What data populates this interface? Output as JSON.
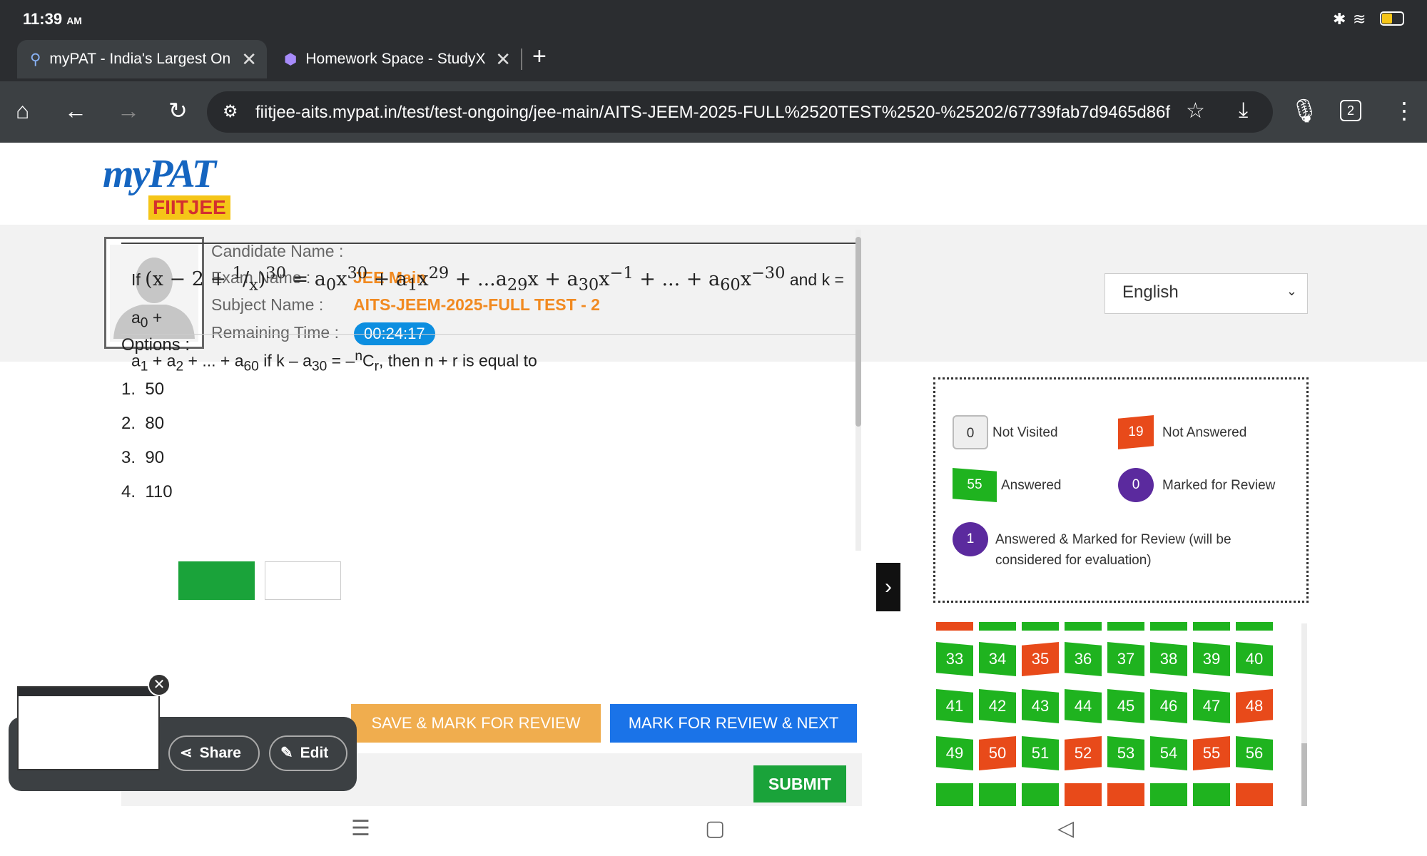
{
  "status": {
    "time": "11:39",
    "ampm": "AM"
  },
  "tabs": [
    {
      "title": "myPAT - India's Largest Online"
    },
    {
      "title": "Homework Space - StudyX"
    }
  ],
  "address": {
    "url": "fiitjee-aits.mypat.in/test/test-ongoing/jee-main/AITS-JEEM-2025-FULL%2520TEST%2520-%25202/67739fab7d9465d86f",
    "tab_count": "2"
  },
  "logo": {
    "top": "myPAT",
    "bottom": "FIITJEE"
  },
  "candidate": {
    "name_label": "Candidate Name :",
    "exam_label": "Exam Name :",
    "exam_value": "JEE Main",
    "subject_label": "Subject Name :",
    "subject_value": "AITS-JEEM-2025-FULL TEST - 2",
    "time_label": "Remaining Time :",
    "time_value": "00:24:17"
  },
  "language": "English",
  "question": {
    "options_label": "Options :",
    "options": [
      {
        "num": "1.",
        "text": "50"
      },
      {
        "num": "2.",
        "text": "80"
      },
      {
        "num": "3.",
        "text": "90"
      },
      {
        "num": "4.",
        "text": "110"
      }
    ]
  },
  "buttons": {
    "save_mark": "SAVE & MARK FOR REVIEW",
    "mark_next": "MARK FOR REVIEW & NEXT",
    "submit": "SUBMIT"
  },
  "legend": {
    "not_visited": {
      "count": "0",
      "label": "Not Visited"
    },
    "not_answered": {
      "count": "19",
      "label": "Not Answered"
    },
    "answered": {
      "count": "55",
      "label": "Answered"
    },
    "marked": {
      "count": "0",
      "label": "Marked for Review"
    },
    "answered_marked": {
      "count": "1",
      "label": "Answered & Marked for Review (will be considered for evaluation)"
    }
  },
  "palette": {
    "answered_color": "#1fb31f",
    "not_answered_color": "#e84a1a",
    "numbers": [
      33,
      34,
      35,
      36,
      37,
      38,
      39,
      40,
      41,
      42,
      43,
      44,
      45,
      46,
      47,
      48,
      49,
      50,
      51,
      52,
      53,
      54,
      55,
      56
    ],
    "not_answered": [
      35,
      48,
      50,
      52,
      55
    ]
  },
  "screenshot_popup": {
    "share": "Share",
    "edit": "Edit"
  }
}
